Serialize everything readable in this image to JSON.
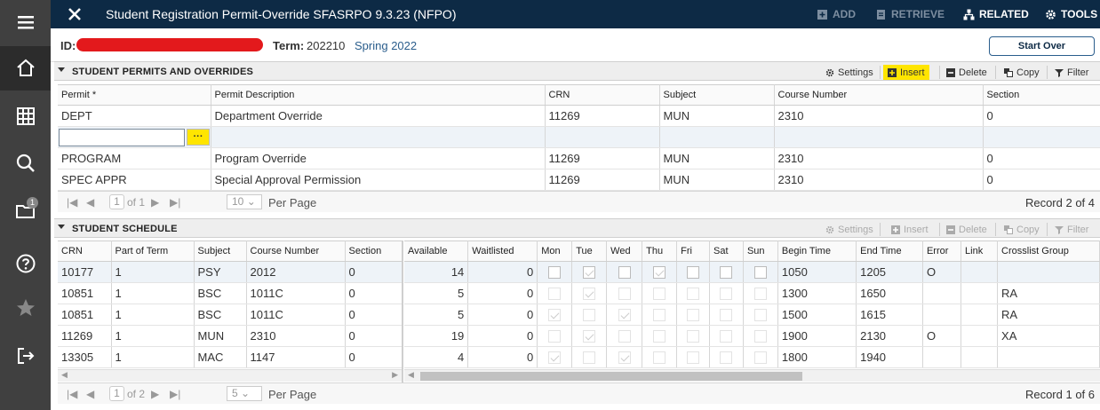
{
  "sidebar": {
    "items": [
      {
        "name": "menu-icon"
      },
      {
        "name": "home-icon"
      },
      {
        "name": "grid-icon"
      },
      {
        "name": "search-icon"
      },
      {
        "name": "folder-icon",
        "badge": "1"
      },
      {
        "name": "help-icon"
      },
      {
        "name": "star-icon"
      },
      {
        "name": "signout-icon"
      }
    ]
  },
  "topbar": {
    "title": "Student Registration Permit-Override SFASRPO 9.3.23 (NFPO)",
    "add": "ADD",
    "retrieve": "RETRIEVE",
    "related": "RELATED",
    "tools": "TOOLS"
  },
  "key": {
    "id_label": "ID:",
    "term_label": "Term:",
    "term_code": "202210",
    "term_desc": "Spring 2022",
    "start_over": "Start Over"
  },
  "permits": {
    "title": "STUDENT PERMITS AND OVERRIDES",
    "tools": {
      "settings": "Settings",
      "insert": "Insert",
      "delete": "Delete",
      "copy": "Copy",
      "filter": "Filter"
    },
    "columns": [
      "Permit *",
      "Permit Description",
      "CRN",
      "Subject",
      "Course Number",
      "Section"
    ],
    "rows": [
      [
        "DEPT",
        "Department Override",
        "11269",
        "MUN",
        "2310",
        "0"
      ],
      [
        "",
        "",
        "",
        "",
        "",
        ""
      ],
      [
        "PROGRAM",
        "Program Override",
        "11269",
        "MUN",
        "2310",
        "0"
      ],
      [
        "SPEC APPR",
        "Special Approval Permission",
        "11269",
        "MUN",
        "2310",
        "0"
      ]
    ],
    "pager": {
      "page": "1",
      "of": "of 1",
      "per_page": "10",
      "per_page_label": "Per Page",
      "record": "Record 2 of 4"
    }
  },
  "schedule": {
    "title": "STUDENT SCHEDULE",
    "tools": {
      "settings": "Settings",
      "insert": "Insert",
      "delete": "Delete",
      "copy": "Copy",
      "filter": "Filter"
    },
    "left_columns": [
      "CRN",
      "Part of Term",
      "Subject",
      "Course Number",
      "Section"
    ],
    "right_columns": [
      "Available",
      "Waitlisted",
      "Mon",
      "Tue",
      "Wed",
      "Thu",
      "Fri",
      "Sat",
      "Sun",
      "Begin Time",
      "End Time",
      "Error",
      "Link",
      "Crosslist Group"
    ],
    "rows": [
      {
        "crn": "10177",
        "pot": "1",
        "subj": "PSY",
        "course": "2012",
        "sect": "0",
        "avail": "14",
        "wait": "0",
        "days": [
          0,
          1,
          0,
          1,
          0,
          0,
          0
        ],
        "begin": "1050",
        "end": "1205",
        "error": "O",
        "link": "",
        "xlist": ""
      },
      {
        "crn": "10851",
        "pot": "1",
        "subj": "BSC",
        "course": "1011C",
        "sect": "0",
        "avail": "5",
        "wait": "0",
        "days": [
          0,
          1,
          0,
          0,
          0,
          0,
          0
        ],
        "begin": "1300",
        "end": "1650",
        "error": "",
        "link": "",
        "xlist": "RA"
      },
      {
        "crn": "10851",
        "pot": "1",
        "subj": "BSC",
        "course": "1011C",
        "sect": "0",
        "avail": "5",
        "wait": "0",
        "days": [
          1,
          0,
          1,
          0,
          0,
          0,
          0
        ],
        "begin": "1500",
        "end": "1615",
        "error": "",
        "link": "",
        "xlist": "RA"
      },
      {
        "crn": "11269",
        "pot": "1",
        "subj": "MUN",
        "course": "2310",
        "sect": "0",
        "avail": "19",
        "wait": "0",
        "days": [
          0,
          1,
          0,
          0,
          0,
          0,
          0
        ],
        "begin": "1900",
        "end": "2130",
        "error": "O",
        "link": "",
        "xlist": "XA"
      },
      {
        "crn": "13305",
        "pot": "1",
        "subj": "MAC",
        "course": "1147",
        "sect": "0",
        "avail": "4",
        "wait": "0",
        "days": [
          1,
          0,
          1,
          0,
          0,
          0,
          0
        ],
        "begin": "1800",
        "end": "1940",
        "error": "",
        "link": "",
        "xlist": ""
      }
    ],
    "pager": {
      "page": "1",
      "of": "of 2",
      "per_page": "5",
      "per_page_label": "Per Page",
      "record": "Record 1 of 6"
    }
  }
}
